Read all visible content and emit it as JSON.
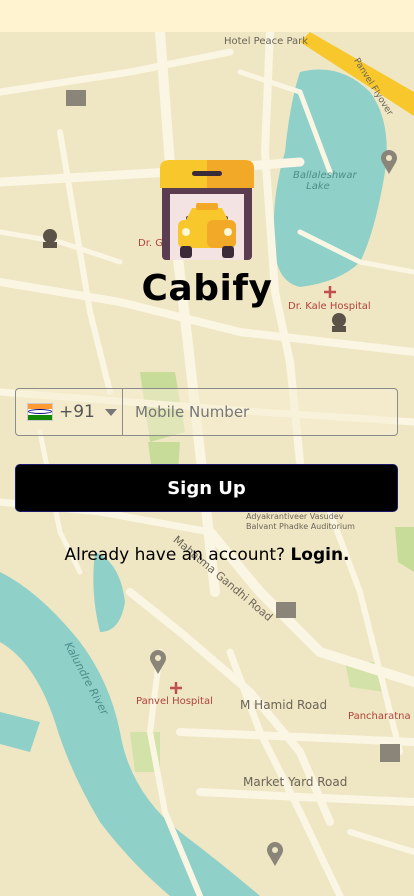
{
  "map": {
    "labels": {
      "hotel": "Hotel Peace Park",
      "lake": "Ballaleshwar Lake",
      "flyover": "Panvel Flyover",
      "kale_hospital": "Dr. Kale Hospital",
      "dr_short": "Dr. G",
      "school": "Adyakrantiveer Vasudev Balvant Phadke Auditorium",
      "gandhi_road": "Mahatma Gandhi Road",
      "river": "Kalundre River",
      "panvel_hospital": "Panvel Hospital",
      "hamid_road": "M Hamid Road",
      "pancharatna": "Pancharatna",
      "market_road": "Market Yard Road"
    }
  },
  "app": {
    "title": "Cabify",
    "logo_icon": "taxi-garage-icon"
  },
  "phone": {
    "country_flag": "india-flag-icon",
    "dial_code": "+91",
    "placeholder": "Mobile Number",
    "value": ""
  },
  "signup": {
    "label": "Sign Up"
  },
  "login": {
    "prompt": "Already have an account?",
    "link": "Login."
  },
  "colors": {
    "map_land": "#efe6c4",
    "water": "#8fd0c8",
    "road": "#fbf6e4",
    "park": "#c8dc9a",
    "button": "#000000",
    "accent_yellow": "#f8c72c"
  }
}
